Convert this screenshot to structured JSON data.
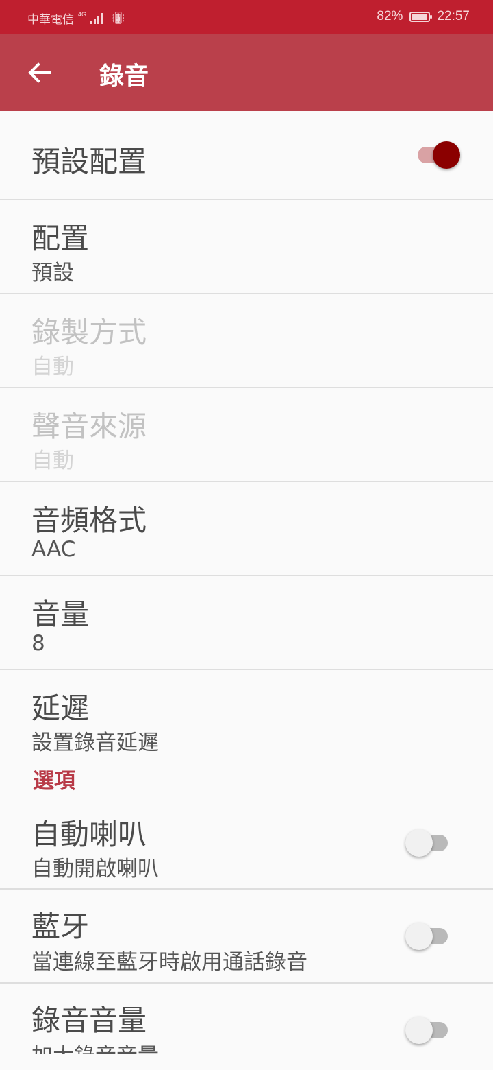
{
  "status_bar": {
    "carrier": "中華電信",
    "network": "4G",
    "battery_text": "82%",
    "battery_level": 0.82,
    "time": "22:57"
  },
  "app_bar": {
    "back_icon": "arrow-left-icon",
    "title": "錄音"
  },
  "items": [
    {
      "title": "預設配置",
      "summary": "",
      "switch": true,
      "enabled": true
    },
    {
      "title": "配置",
      "summary": "預設",
      "enabled": true
    },
    {
      "title": "錄製方式",
      "summary": "自動",
      "enabled": false
    },
    {
      "title": "聲音來源",
      "summary": "自動",
      "enabled": false
    },
    {
      "title": "音頻格式",
      "summary": "AAC",
      "enabled": true
    },
    {
      "title": "音量",
      "summary": "8",
      "enabled": true
    },
    {
      "title": "延遲",
      "summary": "設置錄音延遲",
      "enabled": true
    }
  ],
  "section_options": "選項",
  "option_items": [
    {
      "title": "自動喇叭",
      "summary": "自動開啟喇叭",
      "switch": false
    },
    {
      "title": "藍牙",
      "summary": "當連線至藍牙時啟用通話錄音",
      "switch": false
    },
    {
      "title": "錄音音量",
      "summary": "加大錄音音量",
      "switch": false
    }
  ],
  "colors": {
    "status_bar": "#bf1f2f",
    "app_bar": "#ba404b",
    "accent": "#8b0000",
    "section_header": "#b83a47"
  }
}
